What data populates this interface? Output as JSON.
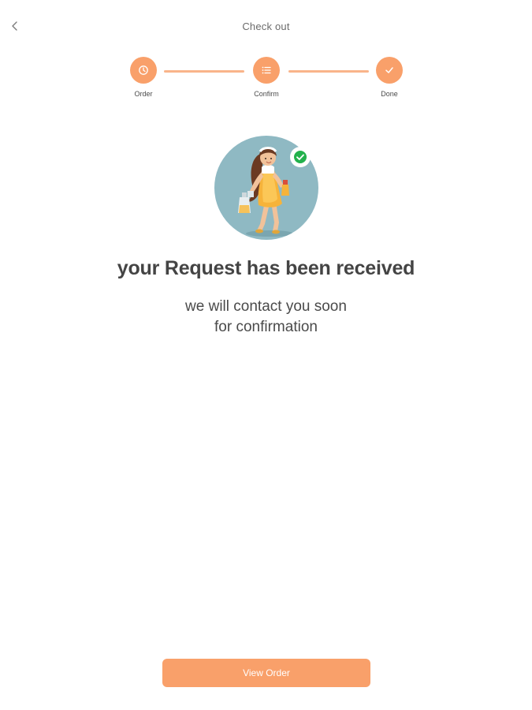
{
  "header": {
    "title": "Check out",
    "back_icon": "chevron-left-icon"
  },
  "stepper": {
    "steps": [
      {
        "label": "Order",
        "icon": "clock-icon",
        "done": true
      },
      {
        "label": "Confirm",
        "icon": "checklist-icon",
        "done": true
      },
      {
        "label": "Done",
        "icon": "check-icon",
        "done": true
      }
    ]
  },
  "confirmation": {
    "headline": "your Request has been received",
    "subtext_line1": "we will contact you soon",
    "subtext_line2": "for confirmation",
    "badge_icon": "check-circle-icon"
  },
  "footer": {
    "view_order_label": "View Order"
  },
  "colors": {
    "accent": "#f9a06a",
    "line": "#f9b48a",
    "illustration_bg": "#8fb9c3",
    "success": "#22b14c"
  }
}
